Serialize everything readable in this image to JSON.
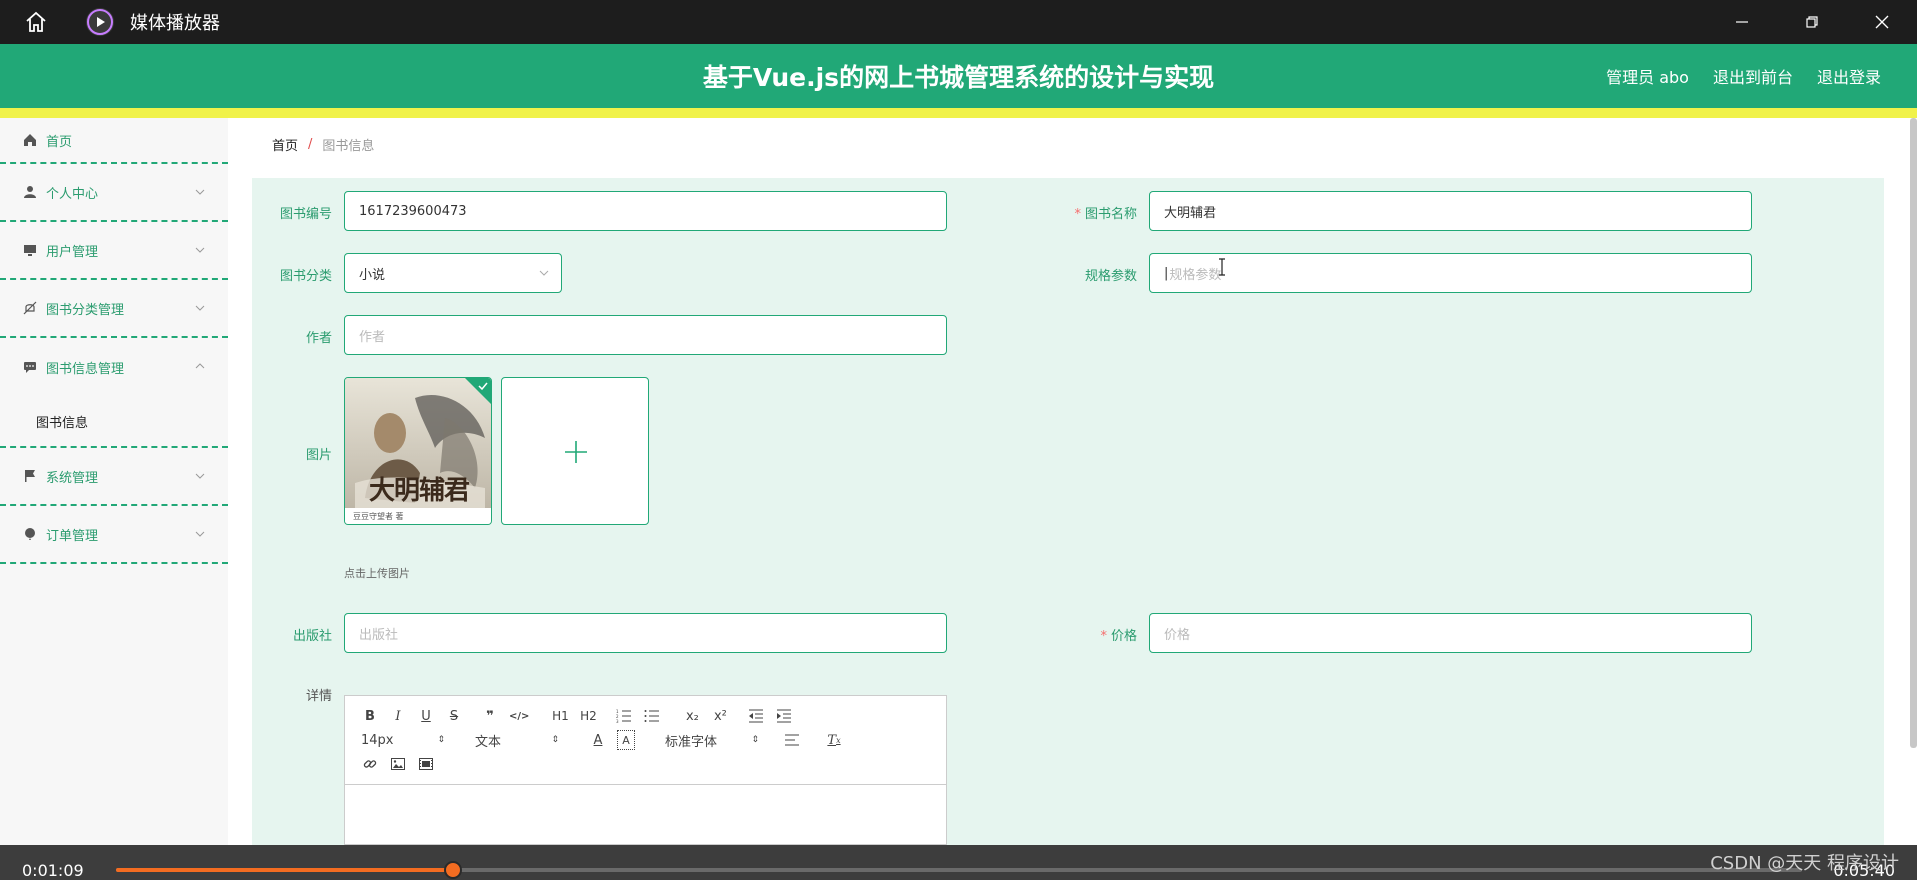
{
  "window": {
    "title": "媒体播放器",
    "controls": [
      "minimize-icon",
      "restore-icon",
      "close-icon"
    ]
  },
  "header": {
    "title": "基于Vue.js的网上书城管理系统的设计与实现",
    "user": "管理员 abo",
    "to_front": "退出到前台",
    "logout": "退出登录"
  },
  "sidebar": {
    "items": [
      {
        "label": "首页",
        "icon": "home-icon"
      },
      {
        "label": "个人中心",
        "icon": "user-icon"
      },
      {
        "label": "用户管理",
        "icon": "monitor-icon"
      },
      {
        "label": "图书分类管理",
        "icon": "bell-off-icon"
      },
      {
        "label": "图书信息管理",
        "icon": "chat-icon",
        "expanded": true
      },
      {
        "label": "系统管理",
        "icon": "flag-icon"
      },
      {
        "label": "订单管理",
        "icon": "balloon-icon"
      }
    ],
    "subitem": "图书信息"
  },
  "breadcrumb": {
    "home": "首页",
    "separator": "/",
    "current": "图书信息"
  },
  "form": {
    "book_no_label": "图书编号",
    "book_no_value": "1617239600473",
    "book_name_label": "图书名称",
    "book_name_value": "大明辅君",
    "category_label": "图书分类",
    "category_value": "小说",
    "spec_label": "规格参数",
    "spec_placeholder": "规格参数",
    "author_label": "作者",
    "author_placeholder": "作者",
    "image_label": "图片",
    "cover_title": "大明辅君",
    "cover_author": "豆豆守望者 著",
    "upload_tip": "点击上传图片",
    "publisher_label": "出版社",
    "publisher_placeholder": "出版社",
    "price_label": "价格",
    "price_placeholder": "价格",
    "detail_label": "详情",
    "required_mark": "*"
  },
  "editor": {
    "row1": [
      "B",
      "I",
      "U",
      "S",
      "❞",
      "</>",
      "H1",
      "H2",
      "ol",
      "ul",
      "x₂",
      "x²",
      "outdent",
      "indent"
    ],
    "size": "14px",
    "header": "文本",
    "font": "标准字体",
    "row3": [
      "link-icon",
      "image-icon",
      "video-icon"
    ]
  },
  "player": {
    "current": "0:01:09",
    "end": "0:05:40",
    "progress": 0.2
  },
  "watermark": "CSDN @天天 程序设计",
  "colors": {
    "primary": "#21a877",
    "accent_yellow": "#f0f24a",
    "progress": "#f36c21"
  }
}
